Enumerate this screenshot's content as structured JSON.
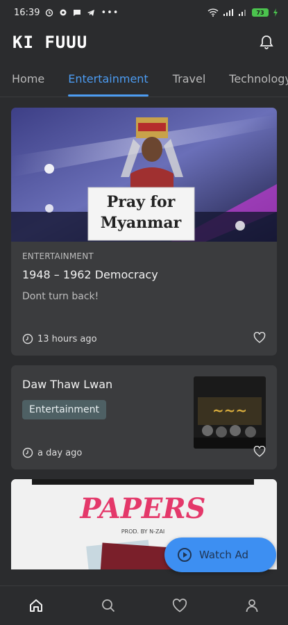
{
  "status_bar": {
    "time": "16:39",
    "battery": "73"
  },
  "app": {
    "logo": "KI FUUU"
  },
  "tabs": [
    {
      "label": "Home",
      "active": false
    },
    {
      "label": "Entertainment",
      "active": true
    },
    {
      "label": "Travel",
      "active": false
    },
    {
      "label": "Technology",
      "active": false
    }
  ],
  "feed": {
    "card1": {
      "image_text_line1": "Pray for",
      "image_text_line2": "Myanmar",
      "category": "ENTERTAINMENT",
      "title": "1948 – 1962  Democracy",
      "subtitle": "Dont turn back!",
      "time": "13 hours ago"
    },
    "card2": {
      "title": "Daw Thaw Lwan",
      "chip": "Entertainment",
      "time": "a day ago"
    },
    "card3": {
      "image_text": "PAPERS",
      "image_credit": "PROD. BY N-ZAI"
    }
  },
  "fab": {
    "label": "Watch Ad"
  },
  "icons": {
    "bell": "bell-icon",
    "clock": "clock-icon",
    "heart": "heart-icon",
    "home": "home-icon",
    "search": "search-icon",
    "favorites": "heart-icon",
    "profile": "person-icon",
    "play": "play-circle-icon"
  },
  "colors": {
    "background": "#2b2c2e",
    "card": "#3b3c3e",
    "accent": "#4c9cf2",
    "fab": "#3d8ff2",
    "chip": "#4e6064"
  }
}
